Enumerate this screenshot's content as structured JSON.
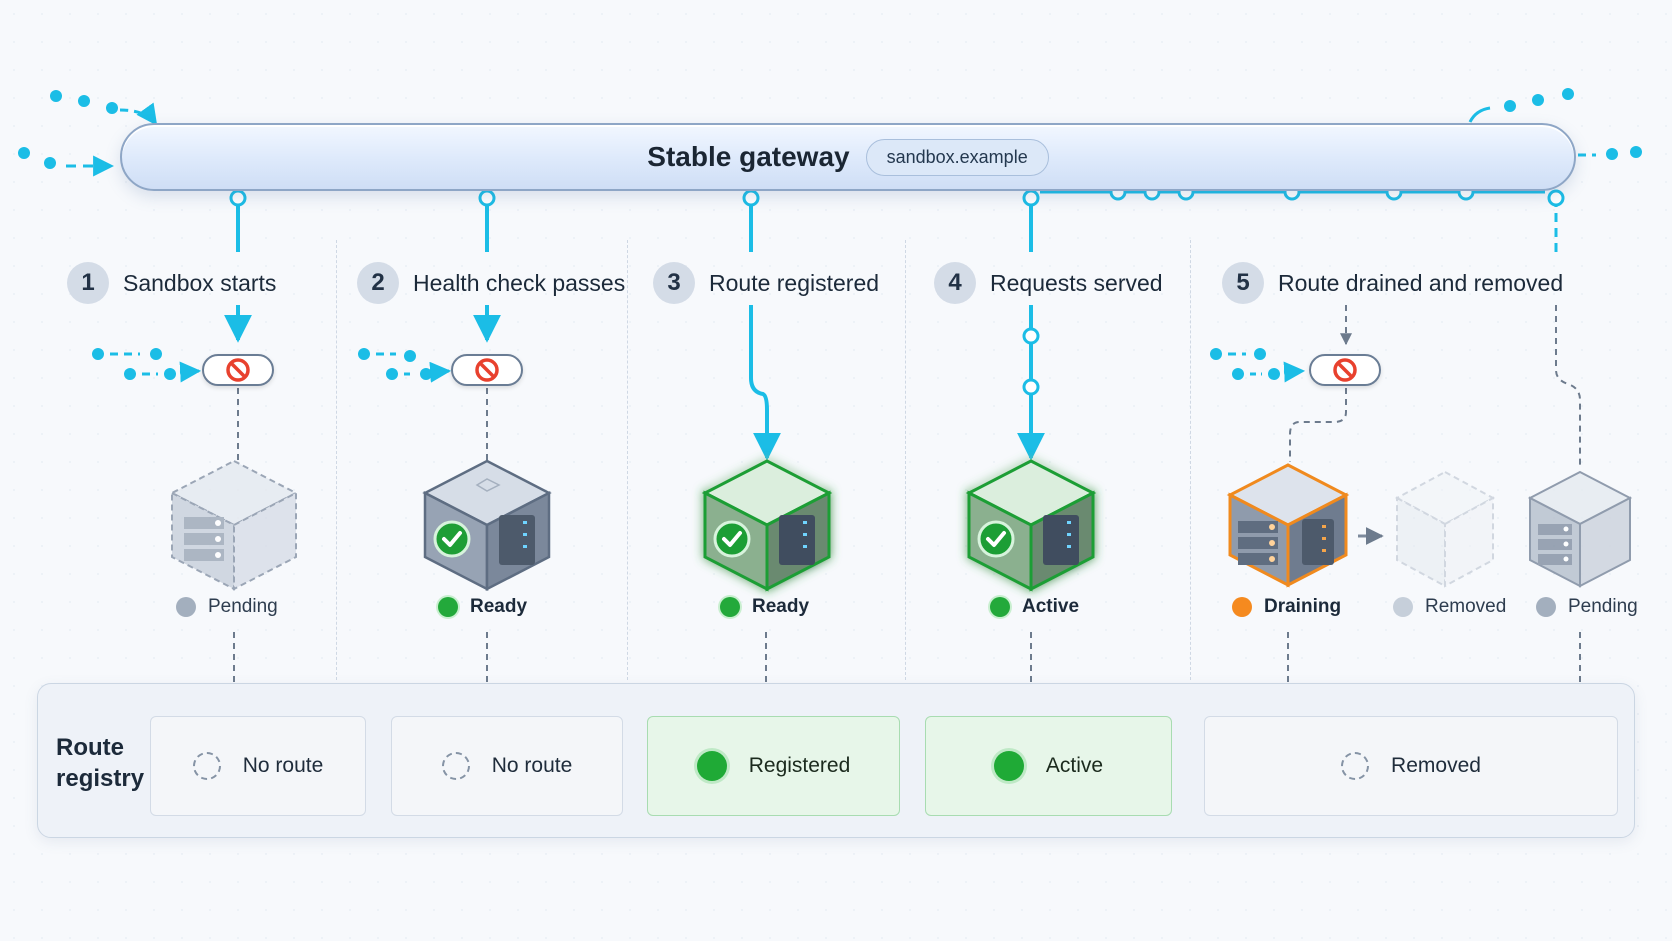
{
  "gateway": {
    "title": "Stable gateway",
    "host": "sandbox.example"
  },
  "steps": [
    {
      "number": "1",
      "label": "Sandbox starts"
    },
    {
      "number": "2",
      "label": "Health check passes"
    },
    {
      "number": "3",
      "label": "Route registered"
    },
    {
      "number": "4",
      "label": "Requests served"
    },
    {
      "number": "5",
      "label": "Route drained and removed"
    }
  ],
  "statuses": [
    "Pending",
    "Ready",
    "Ready",
    "Active",
    "Draining",
    "Removed",
    "Pending"
  ],
  "registry": {
    "title_line1": "Route",
    "title_line2": "registry",
    "cells": [
      "No route",
      "No route",
      "Registered",
      "Active",
      "Removed"
    ]
  },
  "colors": {
    "flow": "#1bbde6",
    "ready": "#23a93b",
    "draining": "#f58a1f",
    "blocked": "#e8412e",
    "pending": "#a3afbe"
  },
  "icons": [
    "server-cube-icon",
    "check-badge-icon",
    "blocked-icon",
    "arrow-right-icon"
  ]
}
